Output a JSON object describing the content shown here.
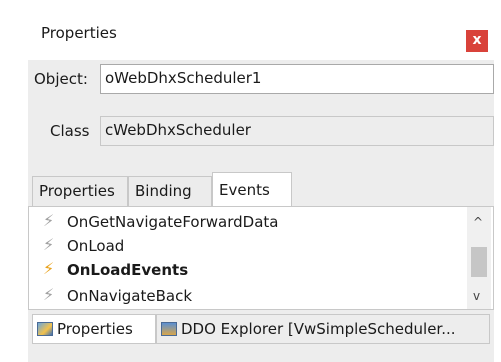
{
  "window": {
    "title": "Properties",
    "close_glyph": "x"
  },
  "object_row": {
    "label": "Object:",
    "value": "oWebDhxScheduler1"
  },
  "class_row": {
    "label": "Class",
    "value": "cWebDhxScheduler"
  },
  "tabs": [
    {
      "label": "Properties",
      "active": false
    },
    {
      "label": "Binding",
      "active": false
    },
    {
      "label": "Events",
      "active": true
    }
  ],
  "events": [
    {
      "label": "OnGetNavigateForwardData",
      "icon": "lightning-icon",
      "active": false
    },
    {
      "label": "OnLoad",
      "icon": "lightning-icon",
      "active": false
    },
    {
      "label": "OnLoadEvents",
      "icon": "lightning-icon",
      "active": true
    },
    {
      "label": "OnNavigateBack",
      "icon": "lightning-icon",
      "active": false
    }
  ],
  "scrollbar": {
    "up_glyph": "^",
    "down_glyph": "v"
  },
  "bottom_tabs": [
    {
      "label": "Properties",
      "icon": "properties-icon",
      "active": true
    },
    {
      "label": "DDO Explorer [VwSimpleScheduler...",
      "icon": "ddo-tree-icon",
      "active": false
    }
  ],
  "colors": {
    "close_button": "#d9423a",
    "active_event_icon": "#e9a21c",
    "panel_bg": "#ededed"
  }
}
